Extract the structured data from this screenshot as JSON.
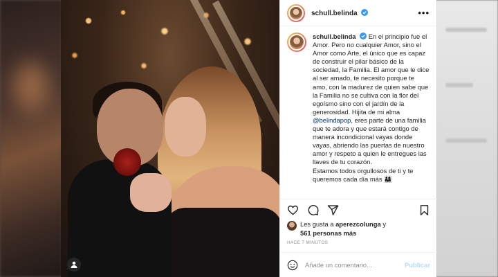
{
  "post": {
    "username": "schull.belinda",
    "caption_lines": [
      "En el principio fue el Amor. Pero no cualquier Amor, sino el Amor como Arte, el único que es capaz de construir el pilar básico de la sociedad, la Familia. El amor que le dice al ser amado, te necesito porque te amo, con la madurez de quien sabe que la Familia no se cultiva con la flor del egoísmo sino con el jardín de la generosidad. Hijita de mi alma",
      "@belindapop",
      ", eres parte de una familia que te adora y que estará contigo de manera incondicional vayas donde vayas, abriendo las puertas de nuestro amor y respeto a quien le entregues las llaves de tu corazón.",
      "Estamos todos orgullosos de ti y te queremos cada día más 👨‍👩‍👧"
    ],
    "likes_prefix": "Les gusta a ",
    "likes_user": "aperezcolunga",
    "likes_mid": " y",
    "likes_count": "561 personas más",
    "timestamp": "HACE 7 MINUTOS",
    "comment_placeholder": "Añade un comentario...",
    "publish_label": "Publicar",
    "more_label": "•••"
  },
  "icons": {
    "verified": "verified-badge-icon",
    "like": "heart-icon",
    "comment": "comment-icon",
    "share": "share-icon",
    "save": "bookmark-icon",
    "emoji": "emoji-icon",
    "profile": "profile-icon"
  },
  "colors": {
    "verified_blue": "#3897f0",
    "publish_disabled": "#b3dbff",
    "mention": "#00376b"
  }
}
